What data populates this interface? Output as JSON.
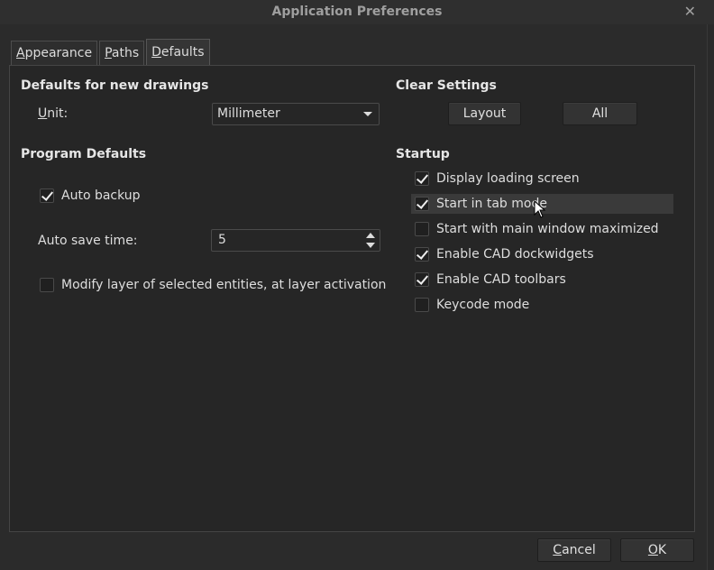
{
  "window": {
    "title": "Application Preferences",
    "close_glyph": "✕"
  },
  "tabs": [
    {
      "accel": "A",
      "rest": "ppearance",
      "active": false
    },
    {
      "accel": "P",
      "rest": "aths",
      "active": false
    },
    {
      "accel": "D",
      "rest": "efaults",
      "active": true
    }
  ],
  "defaults_new": {
    "header": "Defaults for new drawings",
    "unit_accel": "U",
    "unit_rest": "nit:",
    "unit_value": "Millimeter"
  },
  "clear": {
    "header": "Clear Settings",
    "layout_label": "Layout",
    "all_label": "All"
  },
  "program": {
    "header": "Program Defaults",
    "auto_backup": {
      "label": "Auto backup",
      "checked": true
    },
    "autosave_label": "Auto save time:",
    "autosave_value": "5",
    "modify_layer": {
      "label": "Modify layer of selected entities, at  layer activation",
      "checked": false
    }
  },
  "startup": {
    "header": "Startup",
    "items": [
      {
        "label": "Display loading screen",
        "checked": true
      },
      {
        "label": "Start in tab mode",
        "checked": true
      },
      {
        "label": "Start with main window maximized",
        "checked": false
      },
      {
        "label": "Enable CAD dockwidgets",
        "checked": true
      },
      {
        "label": "Enable CAD toolbars",
        "checked": true
      },
      {
        "label": "Keycode mode",
        "checked": false
      }
    ]
  },
  "footer": {
    "cancel_accel": "C",
    "cancel_rest": "ancel",
    "ok_accel": "O",
    "ok_rest": "K"
  }
}
